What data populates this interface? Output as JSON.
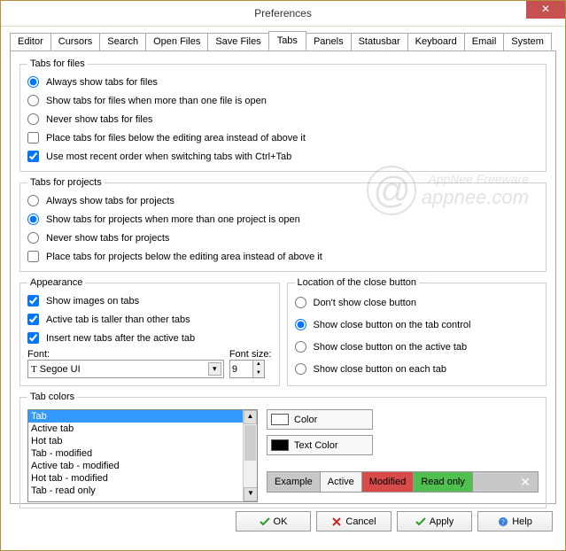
{
  "window": {
    "title": "Preferences"
  },
  "tabs": {
    "items": [
      "Editor",
      "Cursors",
      "Search",
      "Open Files",
      "Save Files",
      "Tabs",
      "Panels",
      "Statusbar",
      "Keyboard",
      "Email",
      "System"
    ],
    "active_index": 5
  },
  "tabs_for_files": {
    "legend": "Tabs for files",
    "opt_always": "Always show tabs for files",
    "opt_multi": "Show tabs for files when more than one file is open",
    "opt_never": "Never show tabs for files",
    "chk_below": "Place tabs for files below the editing area instead of above it",
    "chk_mru": "Use most recent order when switching tabs with Ctrl+Tab",
    "selected": "always",
    "below_checked": false,
    "mru_checked": true
  },
  "tabs_for_projects": {
    "legend": "Tabs for projects",
    "opt_always": "Always show tabs for projects",
    "opt_multi": "Show tabs for projects when more than one project is open",
    "opt_never": "Never show tabs for projects",
    "chk_below": "Place tabs for projects below the editing area instead of above it",
    "selected": "multi",
    "below_checked": false
  },
  "appearance": {
    "legend": "Appearance",
    "chk_images": "Show images on tabs",
    "chk_taller": "Active tab is taller than other tabs",
    "chk_insert": "Insert new tabs after the active tab",
    "images_checked": true,
    "taller_checked": true,
    "insert_checked": true,
    "font_label": "Font:",
    "font_value": "Segoe UI",
    "fontsize_label": "Font size:",
    "fontsize_value": "9"
  },
  "close_location": {
    "legend": "Location of the close button",
    "opt_none": "Don't show close button",
    "opt_control": "Show close button on the tab control",
    "opt_active": "Show close button on the active tab",
    "opt_each": "Show close button on each tab",
    "selected": "control"
  },
  "tab_colors": {
    "legend": "Tab colors",
    "items": [
      "Tab",
      "Active tab",
      "Hot tab",
      "Tab - modified",
      "Active tab - modified",
      "Hot tab - modified",
      "Tab - read only"
    ],
    "selected_index": 0,
    "color_btn": "Color",
    "textcolor_btn": "Text Color",
    "color_swatch": "#ffffff",
    "textcolor_swatch": "#000000",
    "example": {
      "label": "Example",
      "active": {
        "text": "Active",
        "bg": "#f5f5f5",
        "fg": "#000000"
      },
      "modified": {
        "text": "Modified",
        "bg": "#d94a4a",
        "fg": "#000000"
      },
      "readonly": {
        "text": "Read only",
        "bg": "#4fbf4f",
        "fg": "#000000"
      }
    }
  },
  "buttons": {
    "ok": "OK",
    "cancel": "Cancel",
    "apply": "Apply",
    "help": "Help"
  },
  "watermark": {
    "line1": "AppNee Freeware",
    "line2": "appnee.com"
  }
}
